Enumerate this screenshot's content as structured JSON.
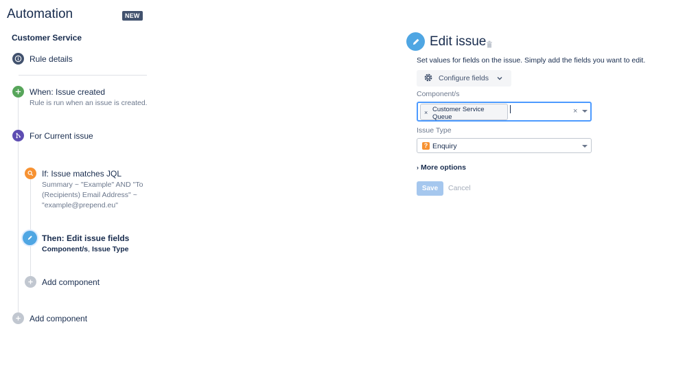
{
  "app": {
    "title": "Automation",
    "badge": "NEW"
  },
  "rule": {
    "name": "Customer Service",
    "nodes": {
      "details": {
        "title": "Rule details",
        "icon": "info-icon",
        "color": "#42526e"
      },
      "trigger": {
        "title": "When: Issue created",
        "description": "Rule is run when an issue is created.",
        "icon": "plus-icon",
        "color": "#57a55a"
      },
      "branch": {
        "title": "For Current issue",
        "icon": "branch-icon",
        "color": "#5e4db2"
      },
      "condition": {
        "title": "If: Issue matches JQL",
        "description_lines": [
          "Summary ~ \"Example\" AND \"To",
          "(Recipients) Email Address\" ~",
          "\"example@prepend.eu\""
        ],
        "icon": "search-icon",
        "color": "#f79232"
      },
      "action": {
        "title": "Then: Edit issue fields",
        "fields_a": "Component/s",
        "separator": ",",
        "fields_b": "Issue Type",
        "icon": "pencil-icon",
        "color": "#4fa6e3"
      },
      "add_inner": {
        "title": "Add component",
        "icon": "plus-icon",
        "color": "#c1c7d0"
      },
      "add_outer": {
        "title": "Add component",
        "icon": "plus-icon",
        "color": "#c1c7d0"
      }
    }
  },
  "editor": {
    "title": "Edit issue",
    "description": "Set values for fields on the issue. Simply add the fields you want to edit.",
    "configure_label": "Configure fields",
    "component_label": "Component/s",
    "component_chip_line1": "Customer Service",
    "component_chip_line2": "Queue",
    "issue_type_label": "Issue Type",
    "issue_type_value": "Enquiry",
    "issue_type_icon": "?",
    "more_options": "More options",
    "save_label": "Save",
    "cancel_label": "Cancel"
  }
}
